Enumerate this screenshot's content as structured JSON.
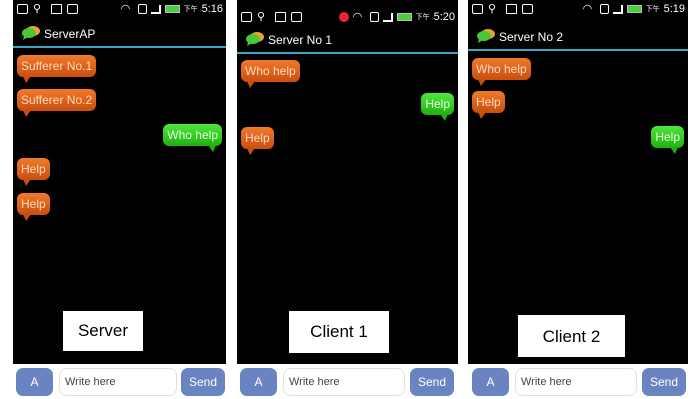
{
  "panels": [
    {
      "status_time": "5:16",
      "status_prefix": "下午",
      "app_title": "ServerAP",
      "messages": [
        {
          "text": "Sufferer No.1",
          "side": "left"
        },
        {
          "text": "Sufferer No.2",
          "side": "left"
        },
        {
          "text": "Who help",
          "side": "right"
        },
        {
          "text": "Help",
          "side": "left"
        },
        {
          "text": "Help",
          "side": "left"
        }
      ],
      "caption": "Server",
      "a_button": "A",
      "input_placeholder": "Write here",
      "send_button": "Send"
    },
    {
      "status_time": "5:20",
      "status_prefix": "下午",
      "app_title": "Server No 1",
      "messages": [
        {
          "text": "Who help",
          "side": "left"
        },
        {
          "text": "Help",
          "side": "right"
        },
        {
          "text": "Help",
          "side": "left"
        }
      ],
      "caption": "Client 1",
      "a_button": "A",
      "input_placeholder": "Write here",
      "send_button": "Send"
    },
    {
      "status_time": "5:19",
      "status_prefix": "下午",
      "app_title": "Server No 2",
      "messages": [
        {
          "text": "Who help",
          "side": "left"
        },
        {
          "text": "Help",
          "side": "left"
        },
        {
          "text": "Help",
          "side": "right"
        }
      ],
      "caption": "Client 2",
      "a_button": "A",
      "input_placeholder": "Write here",
      "send_button": "Send"
    }
  ],
  "colors": {
    "bubble_incoming": "#d9601a",
    "bubble_outgoing": "#2fd11f",
    "title_divider": "#3aa6c8",
    "button_blue": "#6a84c2"
  }
}
